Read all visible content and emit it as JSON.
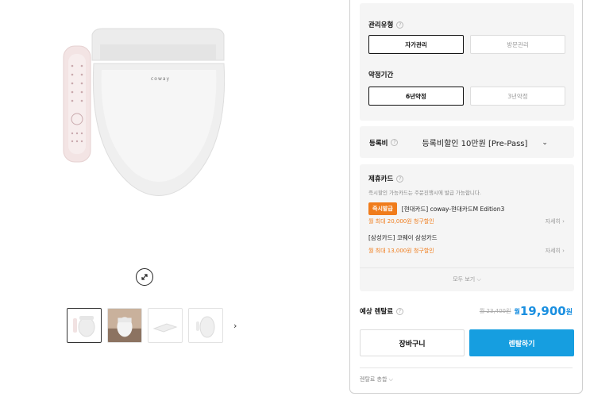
{
  "options": {
    "management_label": "관리유형",
    "management_choices": [
      "자가관리",
      "방문관리"
    ],
    "management_selected": "자가관리",
    "contract_label": "약정기간",
    "contract_choices": [
      "6년약정",
      "3년약정"
    ],
    "contract_selected": "6년약정"
  },
  "registration": {
    "label": "등록비",
    "value": "등록비할인 10만원 [Pre-Pass]"
  },
  "partner_card": {
    "label": "제휴카드",
    "description": "즉시할인 가능카드는 주문진행시에 발급 가능합니다.",
    "badge": "즉시발급",
    "cards": [
      {
        "name": "[현대카드] coway-현대카드M Edition3",
        "discount": "월 최대 20,000원 청구할인",
        "more": "자세히 ›"
      },
      {
        "name": "[삼성카드] 코웨이 삼성카드",
        "discount": "월 최대 13,000원 청구할인",
        "more": "자세히 ›"
      }
    ],
    "see_all": "모두 보기 ⌵"
  },
  "price": {
    "label": "예상 렌탈료",
    "original": "월 23,400원",
    "prefix": "월",
    "amount": "19,900",
    "unit": "원"
  },
  "buttons": {
    "cart": "장바구니",
    "rent": "렌탈하기"
  },
  "total": {
    "label": "렌탈료 총합 ⌵"
  },
  "product": {
    "brand": "coway",
    "thumb_next": "›"
  },
  "colors": {
    "accent_blue": "#1a8fe0",
    "badge_orange": "#f07c1b"
  }
}
